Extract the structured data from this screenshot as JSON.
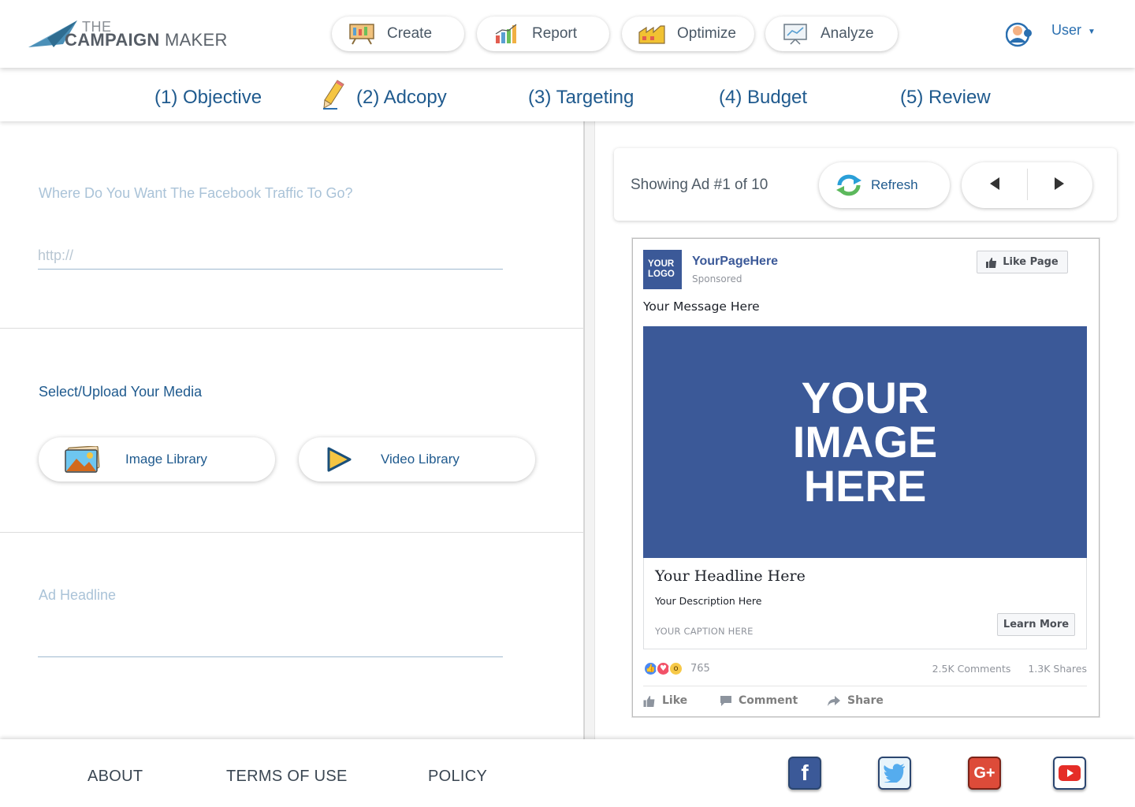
{
  "brand": {
    "the": "THE",
    "name_bold": "CAMPAIGN",
    "name_light": " MAKER"
  },
  "nav": {
    "create": "Create",
    "report": "Report",
    "optimize": "Optimize",
    "analyze": "Analyze"
  },
  "user": {
    "label": "User",
    "caret": "▼"
  },
  "steps": [
    "(1) Objective",
    "(2) Adcopy",
    "(3) Targeting",
    "(4) Budget",
    "(5) Review"
  ],
  "form": {
    "traffic_question": "Where Do You Want The Facebook Traffic To Go?",
    "url_placeholder": "http://",
    "media_title": "Select/Upload Your Media",
    "image_library": "Image Library",
    "video_library": "Video Library",
    "headline_label": "Ad Headline"
  },
  "preview": {
    "showing": "Showing Ad #1 of 10",
    "refresh": "Refresh"
  },
  "ad": {
    "logo_line1": "YOUR",
    "logo_line2": "LOGO",
    "page_name": "YourPageHere",
    "sponsored": "Sponsored",
    "like_page": "Like Page",
    "message": "Your Message Here",
    "image_line1": "YOUR",
    "image_line2": "IMAGE",
    "image_line3": "HERE",
    "headline": "Your Headline Here",
    "description": "Your Description Here",
    "caption": "YOUR CAPTION HERE",
    "cta": "Learn More",
    "reaction_count": "765",
    "comments": "2.5K Comments",
    "shares": "1.3K Shares",
    "like": "Like",
    "comment": "Comment",
    "share": "Share",
    "brand_color": "#3b5998"
  },
  "footer": {
    "about": "ABOUT",
    "terms": "TERMS OF USE",
    "policy": "POLICY",
    "social": [
      {
        "name": "facebook-icon",
        "glyph": "f",
        "color": "#3b5998"
      },
      {
        "name": "twitter-icon",
        "glyph": "t",
        "color": "#55acee"
      },
      {
        "name": "google-plus-icon",
        "glyph": "G+",
        "color": "#dd4b39"
      },
      {
        "name": "youtube-icon",
        "glyph": "▶",
        "color": "#e52d27"
      }
    ]
  }
}
